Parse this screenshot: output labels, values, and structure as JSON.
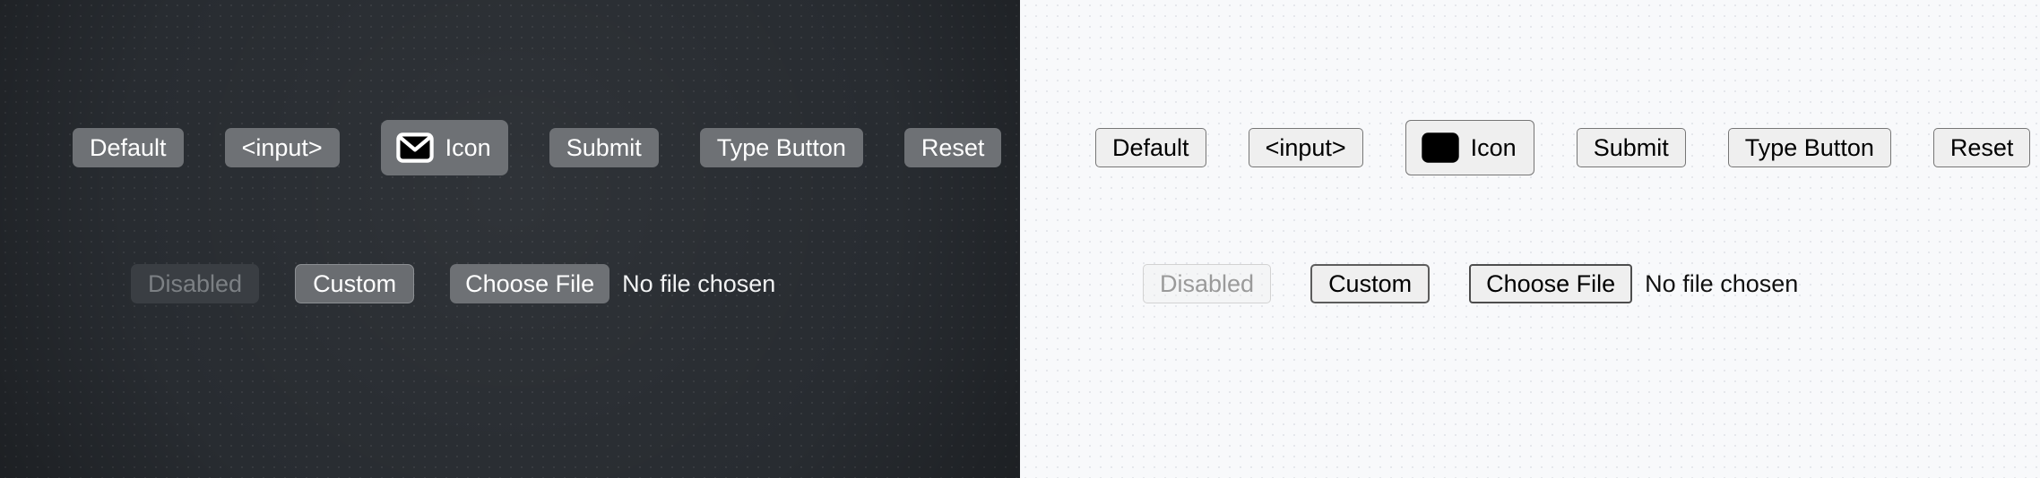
{
  "page": {
    "title": "Button variants — dark and light themes",
    "panels": [
      "dark",
      "light"
    ]
  },
  "theme": {
    "dark": {
      "name": "dark",
      "background": "#282c31",
      "button_fill": "#6e7175",
      "button_text": "#ffffff",
      "disabled_fill": "#3a3e43",
      "disabled_text": "#7c8084",
      "border": "#8b8e92",
      "icon_stroke": "#ffffff",
      "icon_fill": "#000000"
    },
    "light": {
      "name": "light",
      "background": "#f8f9fb",
      "button_fill": "#efefef",
      "button_text": "#000000",
      "disabled_fill": "#efefef",
      "disabled_text": "#9a9a9a",
      "border": "#767676",
      "icon_stroke": "#000000",
      "icon_fill": "#000000"
    }
  },
  "buttons": {
    "default": "Default",
    "input": "<input>",
    "icon": "Icon",
    "submit": "Submit",
    "type_button": "Type Button",
    "reset": "Reset",
    "disabled": "Disabled",
    "custom": "Custom",
    "choose_file": "Choose File"
  },
  "labels": {
    "no_file_chosen": "No file chosen"
  },
  "icons": {
    "envelope": "envelope-icon"
  }
}
